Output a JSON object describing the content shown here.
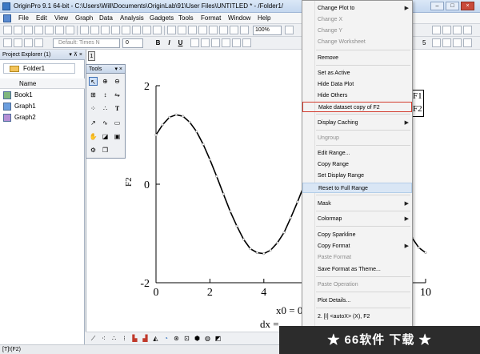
{
  "window": {
    "title": "OriginPro 9.1 64-bit - C:\\Users\\Will\\Documents\\OriginLab\\91\\User Files\\UNTITLED * - /Folder1/",
    "controls": [
      "–",
      "□",
      "×"
    ]
  },
  "menubar": {
    "items": [
      "File",
      "Edit",
      "View",
      "Graph",
      "Data",
      "Analysis",
      "Gadgets",
      "Tools",
      "Format",
      "Window",
      "Help"
    ]
  },
  "toolbar1": {
    "zoom": "100%"
  },
  "toolbar2": {
    "font": "Default: Times N",
    "font_size": "0",
    "bold": "B",
    "italic": "I",
    "underline": "U",
    "size_value": "5"
  },
  "explorer": {
    "title": "Project Explorer (1)",
    "pin": "▾ ⊼ ×",
    "folder": "Folder1",
    "column": "Name",
    "items": [
      {
        "label": "Book1",
        "icon": "workbook-icon"
      },
      {
        "label": "Graph1",
        "icon": "graph-icon"
      },
      {
        "label": "Graph2",
        "icon": "graph-icon"
      }
    ]
  },
  "graph": {
    "layer_label": "1",
    "ylabel": "F2",
    "xlabel_line1": "x0 = 0",
    "xlabel_line2": "dx =",
    "yticks": [
      "2",
      "0",
      "-2"
    ],
    "xticks": [
      "0",
      "2",
      "4",
      "6",
      "8",
      "10"
    ]
  },
  "tools": {
    "title": "Tools",
    "close": "▾ ×",
    "icons": [
      "pointer-icon",
      "zoom-in-icon",
      "zoom-out-icon",
      "screen-reader-icon",
      "data-reader-icon",
      "data-selector-icon",
      "region-icon",
      "data-draw-icon",
      "text-icon",
      "arrow-icon",
      "curve-icon",
      "rectangle-icon",
      "hand-icon",
      "mask-icon",
      "scale-icon",
      "graph-object-icon",
      "copy-icon"
    ]
  },
  "legend": {
    "entries": [
      "F1",
      "F2"
    ]
  },
  "context_menu": {
    "items": [
      {
        "label": "Change Plot to",
        "submenu": true,
        "disabled": false
      },
      {
        "label": "Change X",
        "submenu": false,
        "disabled": true
      },
      {
        "label": "Change Y",
        "submenu": false,
        "disabled": true
      },
      {
        "label": "Change Worksheet",
        "submenu": false,
        "disabled": true
      },
      {
        "label": "Remove",
        "submenu": false,
        "disabled": false
      },
      {
        "label": "Set as Active",
        "submenu": false,
        "disabled": false
      },
      {
        "label": "Hide Data Plot",
        "submenu": false,
        "disabled": false
      },
      {
        "label": "Hide Others",
        "submenu": false,
        "disabled": false
      },
      {
        "label": "Make dataset copy of F2",
        "submenu": false,
        "disabled": false
      },
      {
        "label": "Display Caching",
        "submenu": true,
        "disabled": false
      },
      {
        "label": "Ungroup",
        "submenu": false,
        "disabled": true
      },
      {
        "label": "Edit Range...",
        "submenu": false,
        "disabled": false
      },
      {
        "label": "Copy Range",
        "submenu": false,
        "disabled": false
      },
      {
        "label": "Set Display Range",
        "submenu": false,
        "disabled": false
      },
      {
        "label": "Reset to Full Range",
        "submenu": false,
        "disabled": false
      },
      {
        "label": "Mask",
        "submenu": true,
        "disabled": false
      },
      {
        "label": "Colormap",
        "submenu": true,
        "disabled": false
      },
      {
        "label": "Copy Sparkline",
        "submenu": false,
        "disabled": false
      },
      {
        "label": "Copy Format",
        "submenu": true,
        "disabled": false
      },
      {
        "label": "Paste Format",
        "submenu": false,
        "disabled": true
      },
      {
        "label": "Save Format as Theme...",
        "submenu": false,
        "disabled": false
      },
      {
        "label": "Paste Operation",
        "submenu": false,
        "disabled": true
      },
      {
        "label": "Plot Details...",
        "submenu": false,
        "disabled": false
      },
      {
        "label": "2. [I] <autoX> (X), F2",
        "submenu": false,
        "disabled": false
      }
    ]
  },
  "statusbar": {
    "text": "[T]!(F2)"
  },
  "watermark": {
    "text": "★  66软件 下载  ★"
  },
  "chart_data": {
    "type": "line",
    "x": [
      0,
      0.25,
      0.5,
      0.75,
      1,
      1.25,
      1.5,
      1.75,
      2,
      2.25,
      2.5,
      2.75,
      3,
      3.25,
      3.5,
      3.75,
      4,
      4.25,
      4.5,
      4.75,
      5,
      5.25,
      5.5,
      5.75,
      6,
      6.25,
      6.5,
      6.75,
      7,
      7.25,
      7.5,
      7.75,
      8,
      8.25,
      8.5,
      8.75,
      9,
      9.25,
      9.5,
      9.75,
      10
    ],
    "y": [
      1.0,
      1.21,
      1.36,
      1.41,
      1.38,
      1.26,
      1.07,
      0.81,
      0.5,
      0.16,
      -0.2,
      -0.55,
      -0.85,
      -1.12,
      -1.31,
      -1.39,
      -1.41,
      -1.34,
      -1.19,
      -0.98,
      -0.68,
      -0.36,
      -0.01,
      0.34,
      0.68,
      0.96,
      1.19,
      1.34,
      1.41,
      1.38,
      1.28,
      1.08,
      0.86,
      0.52,
      0.19,
      -0.16,
      -0.5,
      -0.82,
      -1.09,
      -1.29,
      -1.39
    ],
    "xlim": [
      0,
      10
    ],
    "ylim": [
      -2,
      2
    ],
    "ylabel": "F2",
    "series": [
      {
        "name": "F2",
        "color": "#000000"
      }
    ]
  }
}
